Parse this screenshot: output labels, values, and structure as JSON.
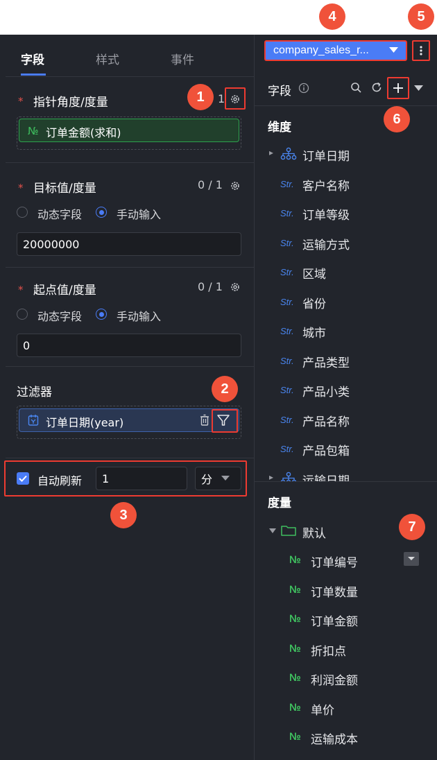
{
  "tabs": [
    "字段",
    "样式",
    "事件"
  ],
  "pointer": {
    "title": "指针角度/度量",
    "count": "1",
    "field": "订单金额(求和)"
  },
  "target": {
    "title": "目标值/度量",
    "count": "0 / 1",
    "opt_dynamic": "动态字段",
    "opt_manual": "手动输入",
    "value": "20000000"
  },
  "start": {
    "title": "起点值/度量",
    "count": "0 / 1",
    "opt_dynamic": "动态字段",
    "opt_manual": "手动输入",
    "value": "0"
  },
  "filter": {
    "title": "过滤器",
    "field": "订单日期(year)"
  },
  "refresh": {
    "label": "自动刷新",
    "value": "1",
    "unit": "分"
  },
  "dataset": {
    "name": "company_sales_r..."
  },
  "fields_header": "字段",
  "dimension": {
    "title": "维度",
    "items": [
      "订单日期",
      "客户名称",
      "订单等级",
      "运输方式",
      "区域",
      "省份",
      "城市",
      "产品类型",
      "产品小类",
      "产品名称",
      "产品包箱",
      "运输日期"
    ]
  },
  "measure": {
    "title": "度量",
    "folder": "默认",
    "items": [
      "订单编号",
      "订单数量",
      "订单金额",
      "折扣点",
      "利润金额",
      "单价",
      "运输成本"
    ]
  },
  "type_labels": {
    "str": "Str.",
    "num": "№"
  },
  "callouts": [
    "1",
    "2",
    "3",
    "4",
    "5",
    "6",
    "7"
  ],
  "colors": {
    "accent": "#4a7cf6",
    "callout": "#f0523a",
    "highlight_border": "#ee3b31",
    "green": "#3fbf5f",
    "panel_bg": "#22252c"
  }
}
